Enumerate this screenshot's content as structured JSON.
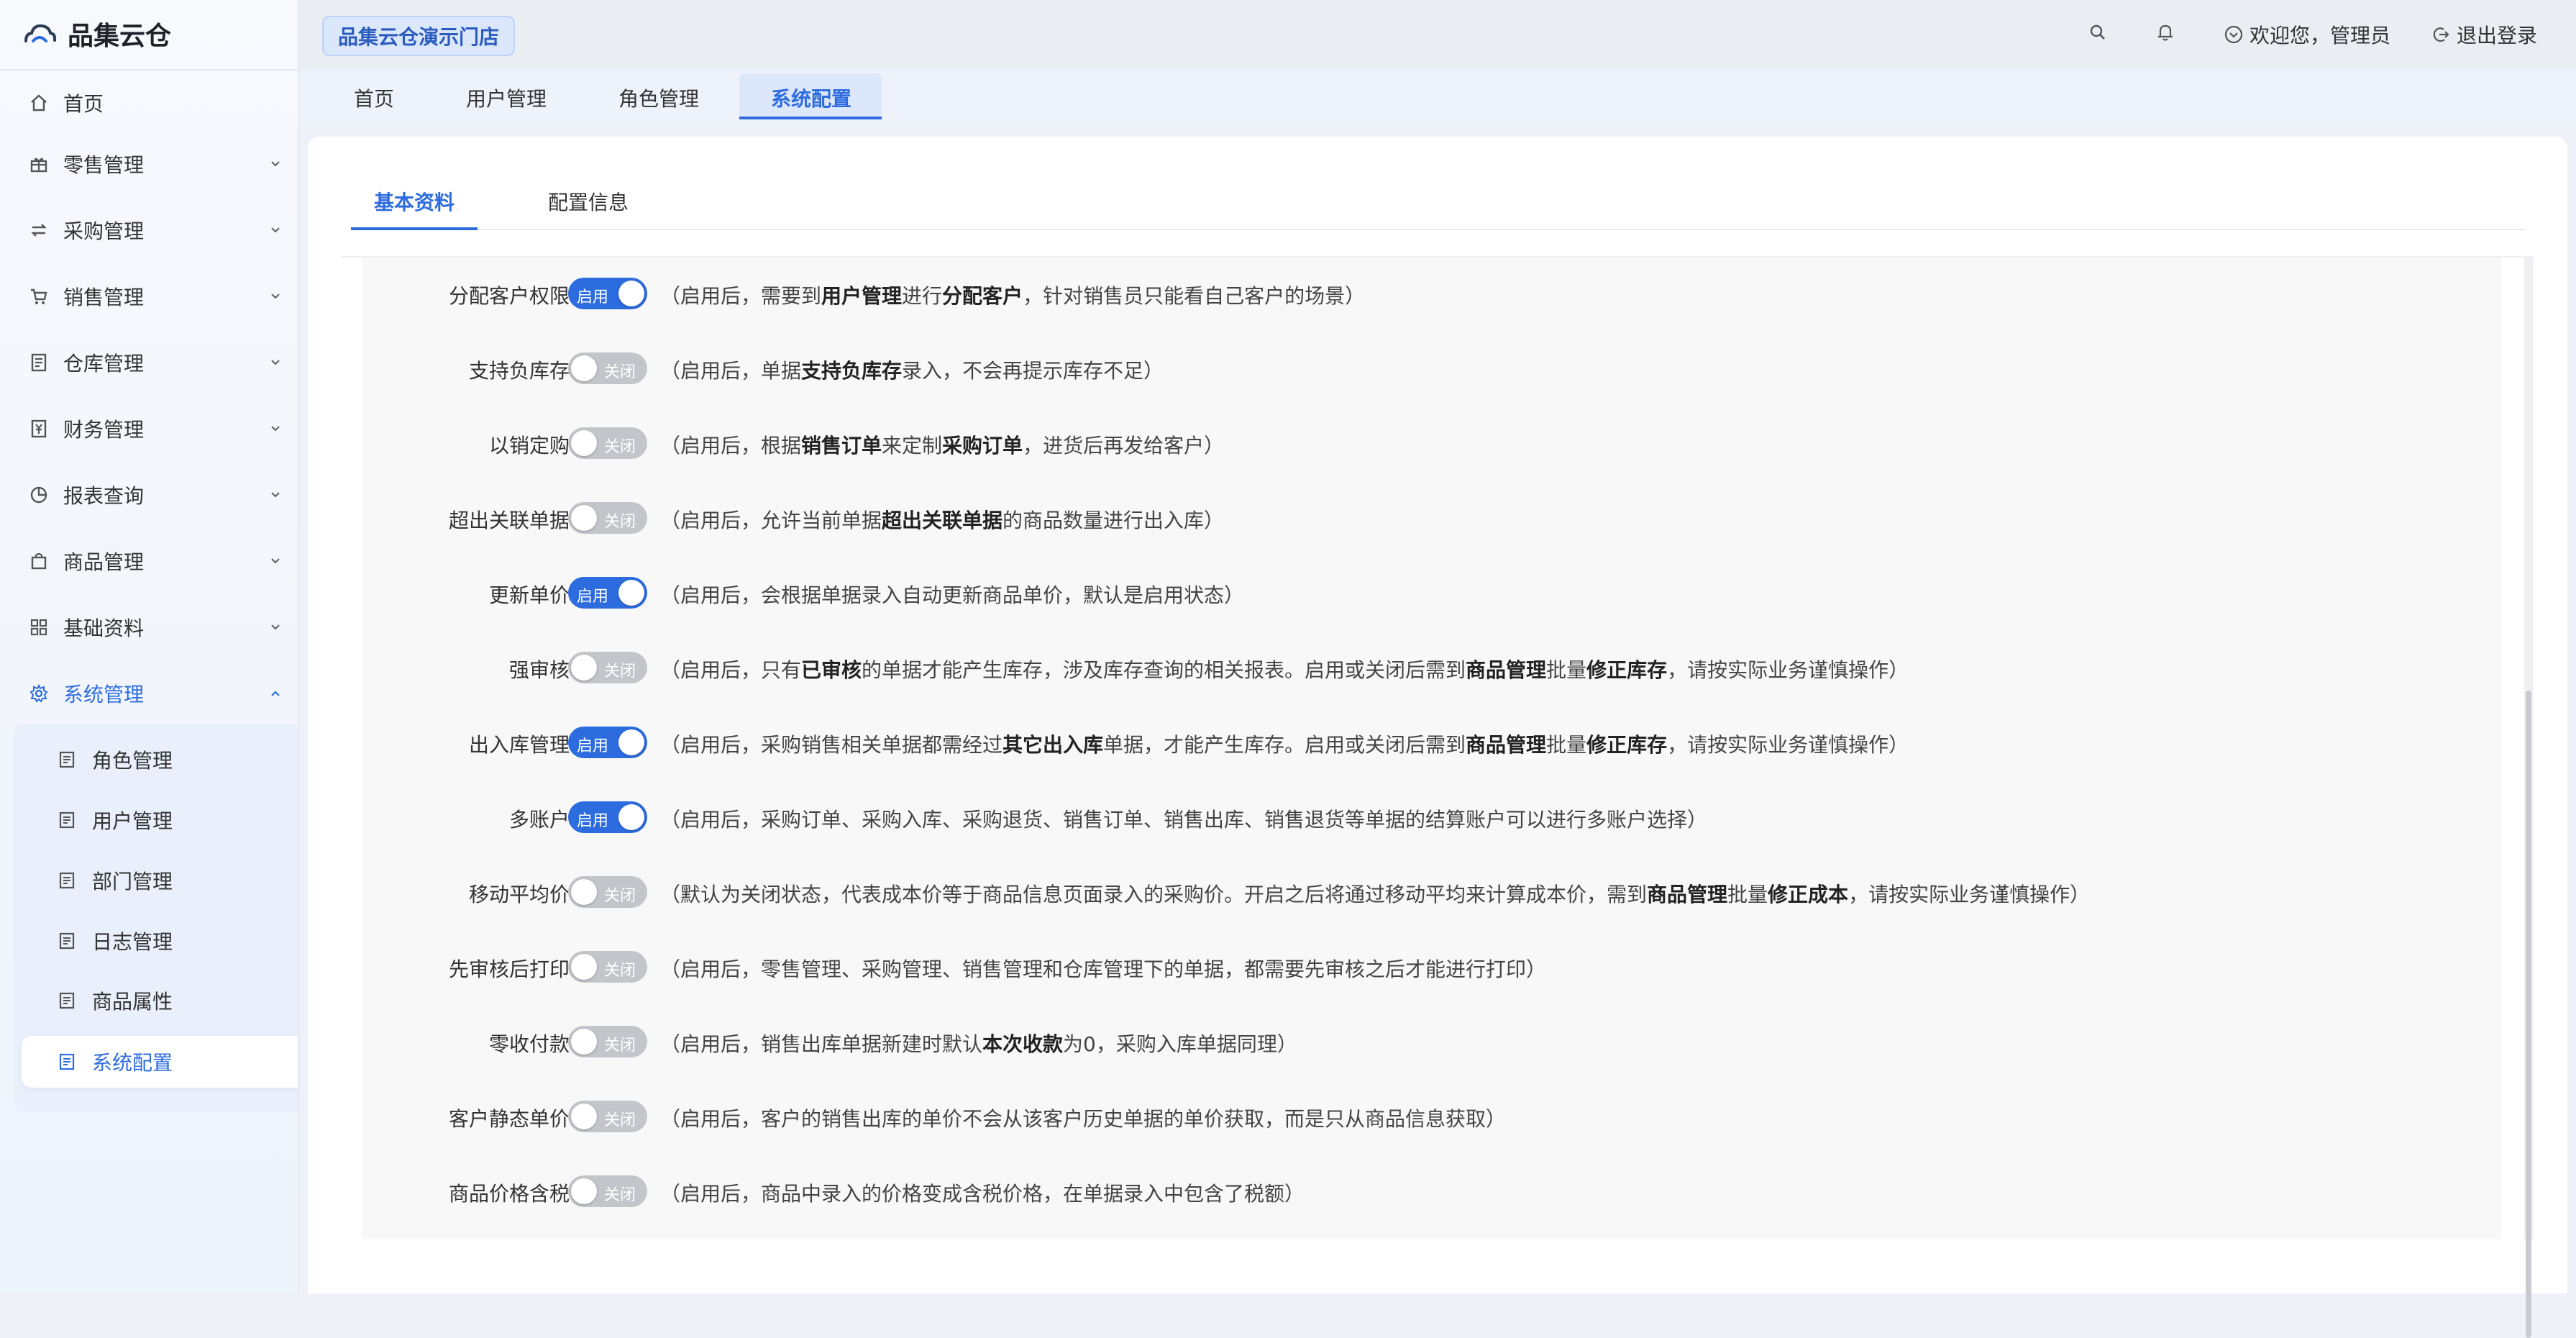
{
  "app": {
    "name": "品集云仓"
  },
  "header": {
    "store": "品集云仓演示门店",
    "welcome": "欢迎您，管理员",
    "logout": "退出登录"
  },
  "sidebar": {
    "items": [
      {
        "label": "首页",
        "icon": "home-icon"
      },
      {
        "label": "零售管理",
        "icon": "gift-icon"
      },
      {
        "label": "采购管理",
        "icon": "swap-icon"
      },
      {
        "label": "销售管理",
        "icon": "cart-icon"
      },
      {
        "label": "仓库管理",
        "icon": "warehouse-icon"
      },
      {
        "label": "财务管理",
        "icon": "finance-icon"
      },
      {
        "label": "报表查询",
        "icon": "pie-chart-icon"
      },
      {
        "label": "商品管理",
        "icon": "bag-icon"
      },
      {
        "label": "基础资料",
        "icon": "grid-icon"
      },
      {
        "label": "系统管理",
        "icon": "gear-icon"
      }
    ],
    "sub_items": [
      {
        "label": "角色管理"
      },
      {
        "label": "用户管理"
      },
      {
        "label": "部门管理"
      },
      {
        "label": "日志管理"
      },
      {
        "label": "商品属性"
      },
      {
        "label": "系统配置"
      }
    ]
  },
  "tabs": [
    {
      "label": "首页"
    },
    {
      "label": "用户管理"
    },
    {
      "label": "角色管理"
    },
    {
      "label": "系统配置"
    }
  ],
  "subtabs": [
    {
      "label": "基本资料"
    },
    {
      "label": "配置信息"
    }
  ],
  "toggle_labels": {
    "on": "启用",
    "off": "关闭"
  },
  "settings": [
    {
      "label": "分配客户权限：",
      "on": true,
      "desc": [
        "（启用后，需要到",
        "用户管理",
        "进行",
        "分配客户",
        "，针对销售员只能看自己客户的场景）"
      ]
    },
    {
      "label": "支持负库存：",
      "on": false,
      "desc": [
        "（启用后，单据",
        "支持负库存",
        "录入，不会再提示库存不足）"
      ]
    },
    {
      "label": "以销定购：",
      "on": false,
      "desc": [
        "（启用后，根据",
        "销售订单",
        "来定制",
        "采购订单",
        "，进货后再发给客户）"
      ]
    },
    {
      "label": "超出关联单据：",
      "on": false,
      "desc": [
        "（启用后，允许当前单据",
        "超出关联单据",
        "的商品数量进行出入库）"
      ]
    },
    {
      "label": "更新单价：",
      "on": true,
      "desc": [
        "（启用后，会根据单据录入自动更新商品单价，默认是启用状态）"
      ]
    },
    {
      "label": "强审核：",
      "on": false,
      "desc": [
        "（启用后，只有",
        "已审核",
        "的单据才能产生库存，涉及库存查询的相关报表。启用或关闭后需到",
        "商品管理",
        "批量",
        "修正库存",
        "，请按实际业务谨慎操作）"
      ]
    },
    {
      "label": "出入库管理：",
      "on": true,
      "desc": [
        "（启用后，采购销售相关单据都需经过",
        "其它出入库",
        "单据，才能产生库存。启用或关闭后需到",
        "商品管理",
        "批量",
        "修正库存",
        "，请按实际业务谨慎操作）"
      ]
    },
    {
      "label": "多账户：",
      "on": true,
      "desc": [
        "（启用后，采购订单、采购入库、采购退货、销售订单、销售出库、销售退货等单据的结算账户可以进行多账户选择）"
      ]
    },
    {
      "label": "移动平均价：",
      "on": false,
      "desc": [
        "（默认为关闭状态，代表成本价等于商品信息页面录入的采购价。开启之后将通过移动平均来计算成本价，需到",
        "商品管理",
        "批量",
        "修正成本",
        "，请按实际业务谨慎操作）"
      ]
    },
    {
      "label": "先审核后打印：",
      "on": false,
      "desc": [
        "（启用后，零售管理、采购管理、销售管理和仓库管理下的单据，都需要先审核之后才能进行打印）"
      ]
    },
    {
      "label": "零收付款：",
      "on": false,
      "desc": [
        "（启用后，销售出库单据新建时默认",
        "本次收款",
        "为0，采购入库单据同理）"
      ]
    },
    {
      "label": "客户静态单价：",
      "on": false,
      "desc": [
        "（启用后，客户的销售出库的单价不会从该客户历史单据的单价获取，而是只从商品信息获取）"
      ]
    },
    {
      "label": "商品价格含税：",
      "on": false,
      "desc": [
        "（启用后，商品中录入的价格变成含税价格，在单据录入中包含了税额）"
      ]
    }
  ]
}
